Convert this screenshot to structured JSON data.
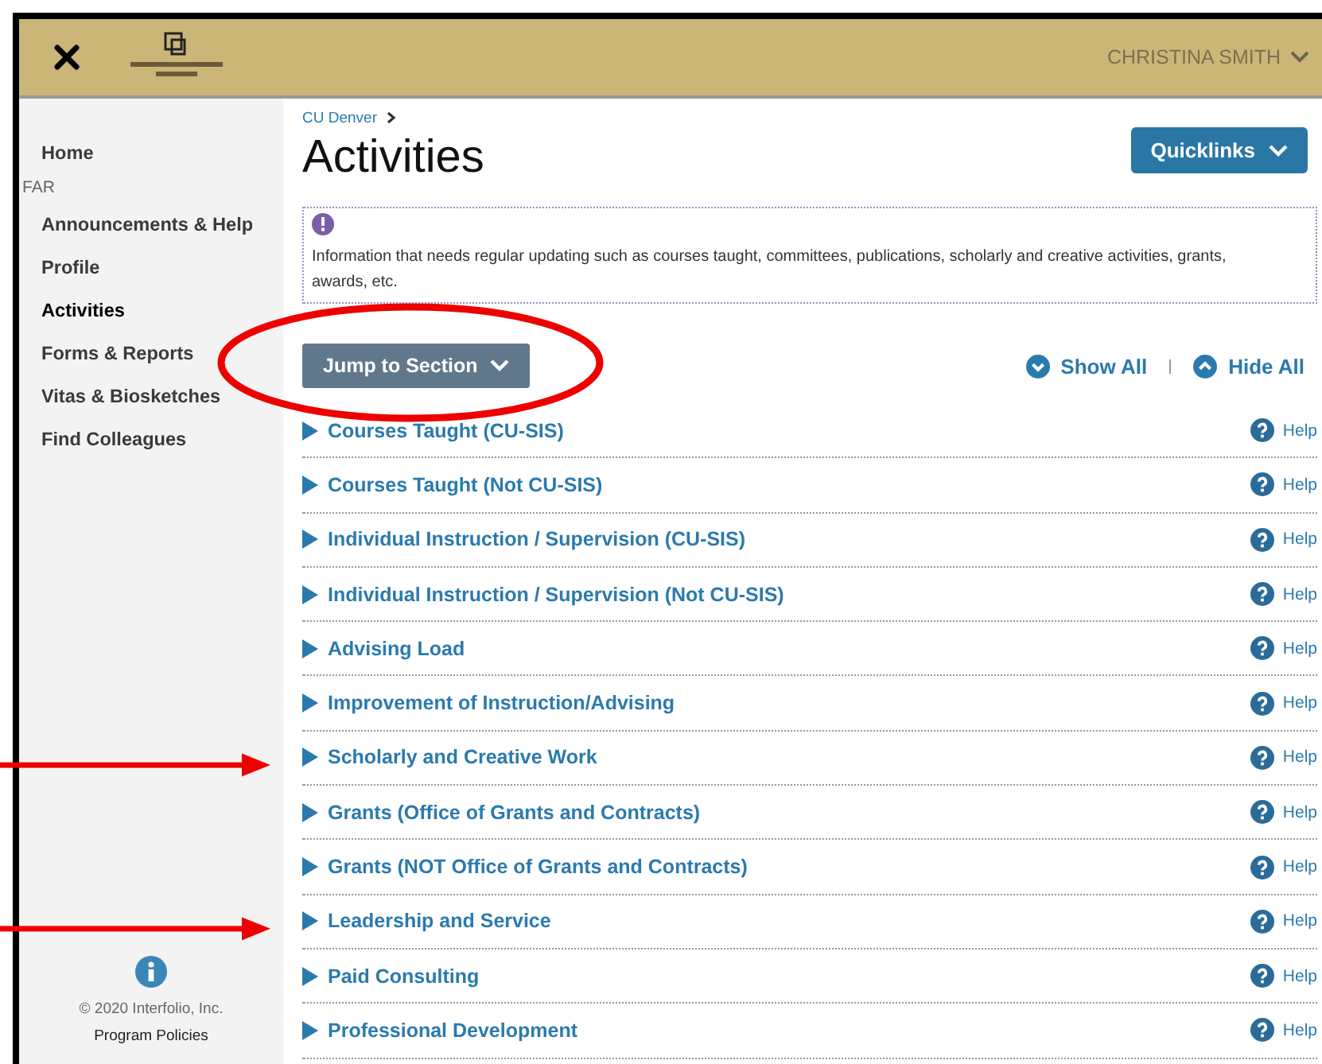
{
  "header": {
    "user": "CHRISTINA SMITH"
  },
  "sidebar": {
    "items": [
      {
        "label": "Home",
        "kind": "link",
        "selected": false
      },
      {
        "label": "FAR",
        "kind": "heading"
      },
      {
        "label": "Announcements & Help",
        "kind": "link",
        "selected": false
      },
      {
        "label": "Profile",
        "kind": "link",
        "selected": false
      },
      {
        "label": "Activities",
        "kind": "link",
        "selected": true
      },
      {
        "label": "Forms & Reports",
        "kind": "link",
        "selected": false
      },
      {
        "label": "Vitas & Biosketches",
        "kind": "link",
        "selected": false
      },
      {
        "label": "Find Colleagues",
        "kind": "link",
        "selected": false
      }
    ],
    "footer": {
      "copyright": "© 2020 Interfolio, Inc.",
      "link": "Program Policies"
    }
  },
  "breadcrumb": "CU Denver",
  "title": "Activities",
  "quicklinks": "Quicklinks",
  "notice": "Information that needs regular updating such as courses taught, committees, publications, scholarly and creative activities, grants, awards, etc.",
  "jump": "Jump to Section",
  "jump_circled": true,
  "show_all": "Show All",
  "hide_all": "Hide All",
  "sections": [
    {
      "label": "Courses Taught (CU-SIS)",
      "help": "Help",
      "expanded": false,
      "arrow": false
    },
    {
      "label": "Courses Taught (Not CU-SIS)",
      "help": "Help",
      "expanded": false,
      "arrow": false
    },
    {
      "label": "Individual Instruction / Supervision (CU-SIS)",
      "help": "Help",
      "expanded": false,
      "arrow": false
    },
    {
      "label": "Individual Instruction / Supervision (Not CU-SIS)",
      "help": "Help",
      "expanded": false,
      "arrow": false
    },
    {
      "label": "Advising Load",
      "help": "Help",
      "expanded": false,
      "arrow": false
    },
    {
      "label": "Improvement of Instruction/Advising",
      "help": "Help",
      "expanded": false,
      "arrow": false
    },
    {
      "label": "Scholarly and Creative Work",
      "help": "Help",
      "expanded": false,
      "arrow": true
    },
    {
      "label": "Grants (Office of Grants and Contracts)",
      "help": "Help",
      "expanded": false,
      "arrow": false
    },
    {
      "label": "Grants (NOT Office of Grants and Contracts)",
      "help": "Help",
      "expanded": false,
      "arrow": false
    },
    {
      "label": "Leadership and Service",
      "help": "Help",
      "expanded": false,
      "arrow": true
    },
    {
      "label": "Paid Consulting",
      "help": "Help",
      "expanded": false,
      "arrow": false
    },
    {
      "label": "Professional Development",
      "help": "Help",
      "expanded": false,
      "arrow": false
    }
  ]
}
